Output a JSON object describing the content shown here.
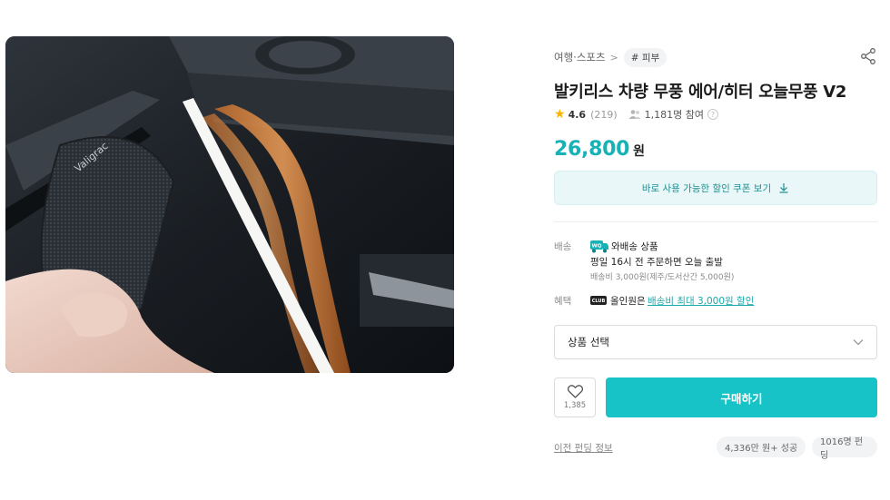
{
  "product": {
    "image": {
      "printed_text": "Valigrac"
    }
  },
  "breadcrumb": {
    "category": "여행·스포츠",
    "tag": "# 피부"
  },
  "title": "발키리스 차량 무풍 에어/히터 오늘무풍 V2",
  "rating": {
    "score": "4.6",
    "count": "(219)",
    "participants": "1,181명 참여"
  },
  "price": {
    "amount": "26,800",
    "unit": "원"
  },
  "coupon": {
    "label": "바로 사용 가능한 할인 쿠폰 보기"
  },
  "shipping": {
    "label": "배송",
    "badge_text": "WQ",
    "title": "와배송 상품",
    "schedule": "평일 16시 전 주문하면 오늘 출발",
    "fee": "배송비 3,000원(제주/도서산간 5,000원)"
  },
  "benefit": {
    "label": "혜택",
    "icon_text": "CLUB",
    "prefix": "올인원은",
    "link": "배송비 최대 3,000원 할인"
  },
  "option_select": {
    "placeholder": "상품 선택"
  },
  "wishlist": {
    "count": "1,385"
  },
  "buy": {
    "label": "구매하기"
  },
  "funding": {
    "prev_label": "이전 펀딩 정보",
    "amount_badge": "4,336만 원+ 성공",
    "people_badge": "1016명 펀딩"
  },
  "colors": {
    "accent": "#17c3c6",
    "price": "#17b2b6",
    "coupon_bg": "#e9f7f8",
    "star": "#f5b700"
  },
  "icons": {
    "share": "share-icon",
    "star": "star-icon",
    "people": "people-icon",
    "help": "help-icon",
    "download": "download-icon",
    "chevron": "chevron-down-icon",
    "heart": "heart-icon"
  }
}
